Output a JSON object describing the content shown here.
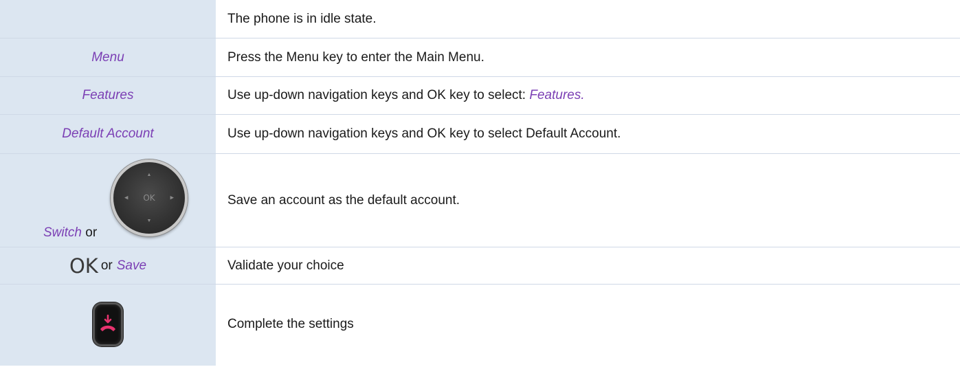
{
  "rows": [
    {
      "left": "",
      "right": "The phone is in idle state."
    },
    {
      "left": "Menu",
      "right": "Press the Menu key to enter the Main Menu."
    },
    {
      "left": "Features",
      "right_prefix": "Use up-down navigation keys and OK key to select: ",
      "right_em": "Features."
    },
    {
      "left": "Default Account",
      "right": "Use up-down navigation keys and OK key to select Default Account."
    },
    {
      "left_em": "Switch",
      "left_or": "or",
      "right": "Save an account as the default account.",
      "nav_ok": "OK"
    },
    {
      "left_big": "OK",
      "left_or": "or",
      "left_em": "Save",
      "right": "Validate your choice"
    },
    {
      "right": "Complete the settings"
    }
  ],
  "colors": {
    "left_bg": "#dce6f1",
    "accent_purple": "#7b3fb4",
    "hangup_red": "#e8336e"
  },
  "icons": {
    "nav_pad": "navigation-pad-icon",
    "hangup": "hangup-key-icon"
  }
}
